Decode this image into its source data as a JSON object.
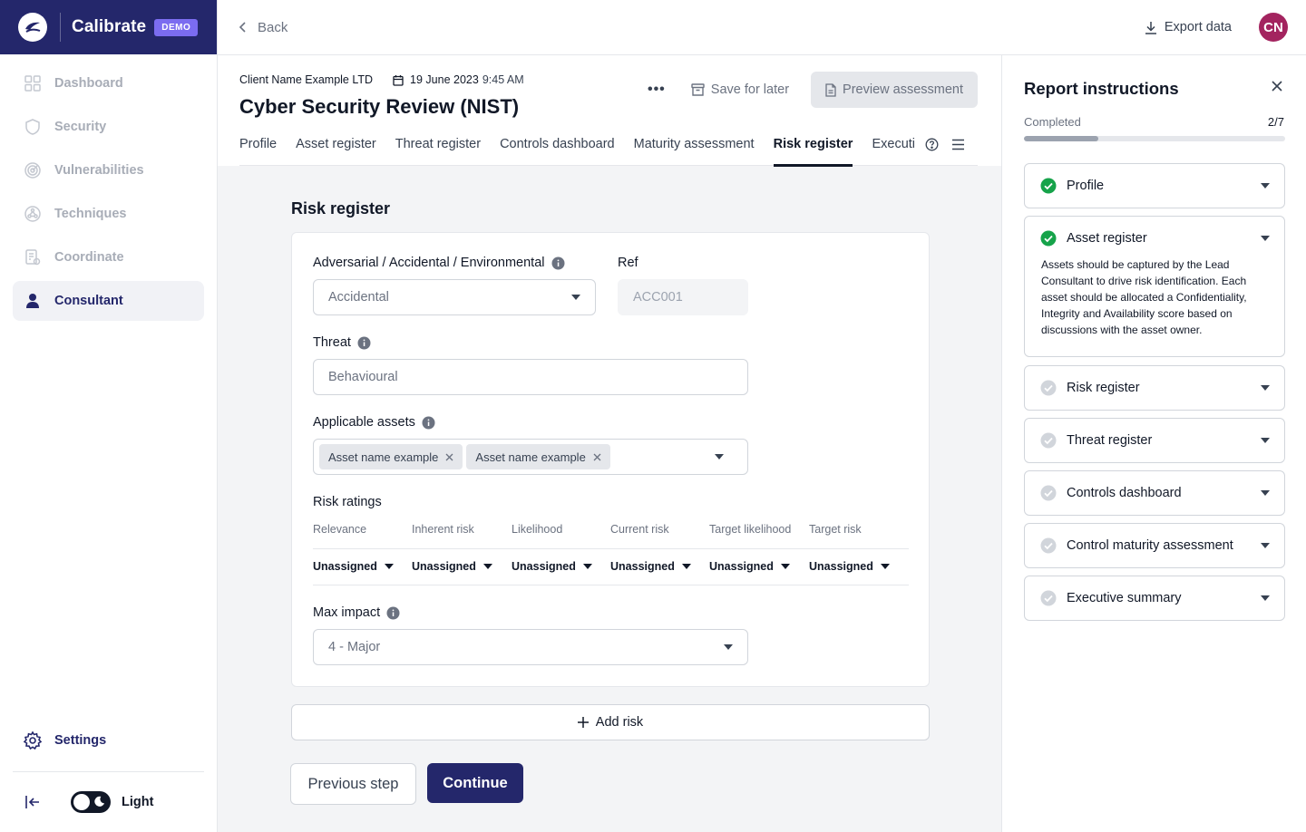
{
  "brand": {
    "name": "Calibrate",
    "badge": "DEMO"
  },
  "nav": {
    "items": [
      {
        "label": "Dashboard",
        "icon": "grid-icon",
        "active": false
      },
      {
        "label": "Security",
        "icon": "shield-icon",
        "active": false
      },
      {
        "label": "Vulnerabilities",
        "icon": "radar-icon",
        "active": false
      },
      {
        "label": "Techniques",
        "icon": "network-icon",
        "active": false
      },
      {
        "label": "Coordinate",
        "icon": "document-list-icon",
        "active": false
      },
      {
        "label": "Consultant",
        "icon": "user-icon",
        "active": true
      }
    ],
    "settings_label": "Settings",
    "theme_label": "Light"
  },
  "topbar": {
    "back_label": "Back",
    "export_label": "Export data",
    "avatar_initials": "CN"
  },
  "header": {
    "client": "Client Name Example LTD",
    "date": "19 June 2023",
    "time": "9:45 AM",
    "title": "Cyber Security Review (NIST)",
    "more_label": "•••",
    "save_label": "Save for later",
    "preview_label": "Preview assessment"
  },
  "tabs": [
    {
      "label": "Profile",
      "active": false
    },
    {
      "label": "Asset register",
      "active": false
    },
    {
      "label": "Threat register",
      "active": false
    },
    {
      "label": "Controls dashboard",
      "active": false
    },
    {
      "label": "Maturity assessment",
      "active": false
    },
    {
      "label": "Risk register",
      "active": true
    },
    {
      "label": "Executive summary",
      "active": false
    }
  ],
  "form": {
    "section_title": "Risk register",
    "type_label": "Adversarial / Accidental / Environmental",
    "type_value": "Accidental",
    "ref_label": "Ref",
    "ref_value": "ACC001",
    "threat_label": "Threat",
    "threat_value": "Behavioural",
    "assets_label": "Applicable assets",
    "assets": [
      "Asset name example",
      "Asset name example"
    ],
    "ratings_label": "Risk ratings",
    "ratings": [
      {
        "name": "Relevance",
        "value": "Unassigned"
      },
      {
        "name": "Inherent risk",
        "value": "Unassigned"
      },
      {
        "name": "Likelihood",
        "value": "Unassigned"
      },
      {
        "name": "Current risk",
        "value": "Unassigned"
      },
      {
        "name": "Target likelihood",
        "value": "Unassigned"
      },
      {
        "name": "Target risk",
        "value": "Unassigned"
      }
    ],
    "impact_label": "Max impact",
    "impact_value": "4 - Major",
    "add_risk_label": "Add risk",
    "prev_label": "Previous step",
    "continue_label": "Continue"
  },
  "report": {
    "title": "Report instructions",
    "completed_label": "Completed",
    "completed_count": "2/7",
    "progress_fraction": 0.2857,
    "sections": [
      {
        "label": "Profile",
        "done": true
      },
      {
        "label": "Asset register",
        "done": true,
        "body": "Assets should be captured by the Lead Consultant to drive risk identification. Each asset should be allocated a Confidentiality, Integrity and Availability score based on discussions with the asset owner."
      },
      {
        "label": "Risk register",
        "done": false
      },
      {
        "label": "Threat register",
        "done": false
      },
      {
        "label": "Controls dashboard",
        "done": false
      },
      {
        "label": "Control maturity assessment",
        "done": false
      },
      {
        "label": "Executive summary",
        "done": false
      }
    ]
  },
  "colors": {
    "brand": "#24276b",
    "badge": "#7b6cf0",
    "avatar": "#a3245f",
    "success": "#16a34a"
  }
}
